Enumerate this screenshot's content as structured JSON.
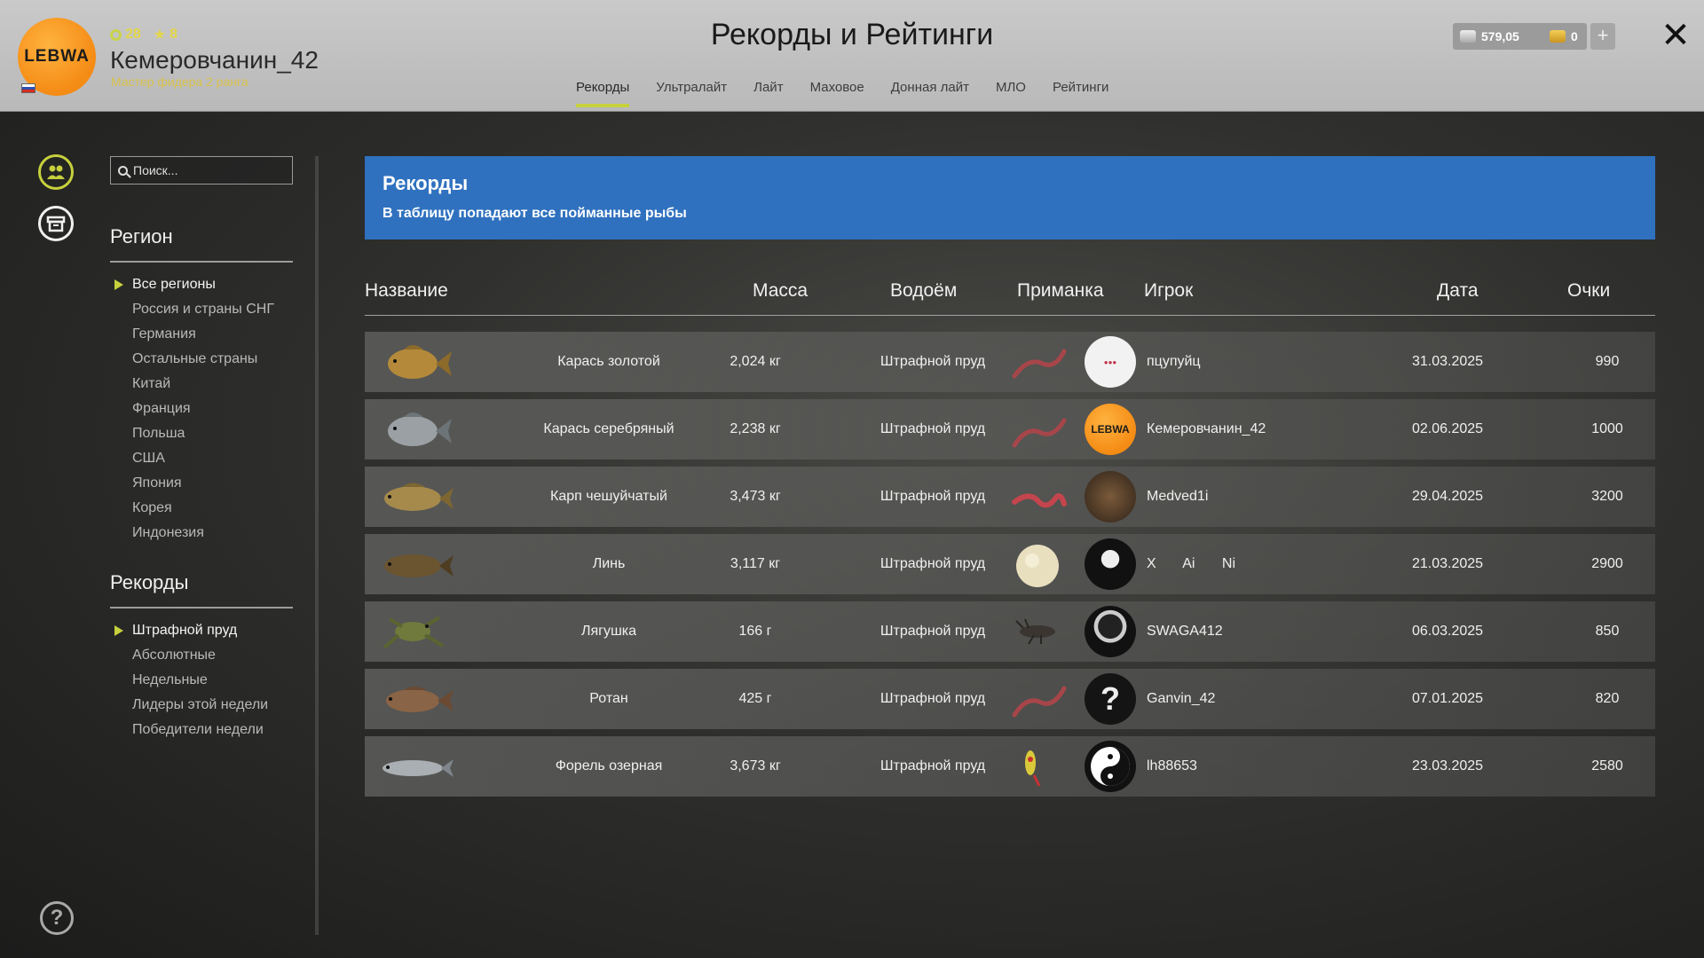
{
  "header": {
    "title": "Рекорды и Рейтинги",
    "logo_text": "LEBWA",
    "level": "28",
    "stars": "8",
    "username": "Кемеровчанин_42",
    "rank": "Мастер фидера 2 ранга",
    "tabs": [
      {
        "label": "Рекорды",
        "active": true
      },
      {
        "label": "Ультралайт"
      },
      {
        "label": "Лайт"
      },
      {
        "label": "Маховое"
      },
      {
        "label": "Донная лайт"
      },
      {
        "label": "МЛО"
      },
      {
        "label": "Рейтинги"
      }
    ],
    "silver": "579,05",
    "gold": "0",
    "plus": "+",
    "close": "✕"
  },
  "sidebar": {
    "search_placeholder": "Поиск...",
    "region_title": "Регион",
    "regions": [
      "Все регионы",
      "Россия и страны СНГ",
      "Германия",
      "Остальные страны",
      "Китай",
      "Франция",
      "Польша",
      "США",
      "Япония",
      "Корея",
      "Индонезия"
    ],
    "records_title": "Рекорды",
    "records": [
      "Штрафной пруд",
      "Абсолютные",
      "Недельные",
      "Лидеры этой недели",
      "Победители недели"
    ]
  },
  "banner": {
    "title": "Рекорды",
    "subtitle": "В таблицу попадают все пойманные рыбы"
  },
  "table": {
    "headers": {
      "name": "Название",
      "mass": "Масса",
      "water": "Водоём",
      "bait": "Приманка",
      "player": "Игрок",
      "date": "Дата",
      "points": "Очки"
    },
    "rows": [
      {
        "name": "Карась золотой",
        "mass": "2,024 кг",
        "water": "Штрафной пруд",
        "player": "пцупуйц",
        "date": "31.03.2025",
        "points": "990"
      },
      {
        "name": "Карась серебряный",
        "mass": "2,238 кг",
        "water": "Штрафной пруд",
        "player": "Кемеровчанин_42",
        "date": "02.06.2025",
        "points": "1000"
      },
      {
        "name": "Карп чешуйчатый",
        "mass": "3,473 кг",
        "water": "Штрафной пруд",
        "player": "Medved1i",
        "date": "29.04.2025",
        "points": "3200"
      },
      {
        "name": "Линь",
        "mass": "3,117 кг",
        "water": "Штрафной пруд",
        "player": "X Ai Ni",
        "date": "21.03.2025",
        "points": "2900"
      },
      {
        "name": "Лягушка",
        "mass": "166 г",
        "water": "Штрафной пруд",
        "player": "SWAGA412",
        "date": "06.03.2025",
        "points": "850"
      },
      {
        "name": "Ротан",
        "mass": "425 г",
        "water": "Штрафной пруд",
        "player": "Ganvin_42",
        "date": "07.01.2025",
        "points": "820"
      },
      {
        "name": "Форель озерная",
        "mass": "3,673 кг",
        "water": "Штрафной пруд",
        "player": "lh88653",
        "date": "23.03.2025",
        "points": "2580"
      }
    ]
  },
  "icons": {
    "friends": "friends-icon",
    "archive": "archive-icon",
    "help": "?"
  }
}
